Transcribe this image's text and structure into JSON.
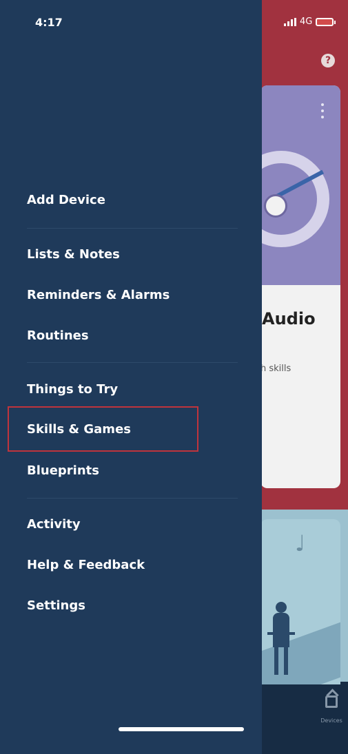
{
  "status_bar": {
    "time": "4:17",
    "network": "4G"
  },
  "drawer": {
    "items": [
      {
        "label": "Add Device"
      },
      {
        "label": "Lists & Notes"
      },
      {
        "label": "Reminders & Alarms"
      },
      {
        "label": "Routines"
      },
      {
        "label": "Things to Try"
      },
      {
        "label": "Skills & Games",
        "highlighted": true
      },
      {
        "label": "Blueprints"
      },
      {
        "label": "Activity"
      },
      {
        "label": "Help & Feedback"
      },
      {
        "label": "Settings"
      }
    ]
  },
  "background_app": {
    "help_icon_label": "?",
    "card_title": "Audio",
    "card_subtitle": "h skills",
    "bottom_tab_label": "Devices"
  },
  "colors": {
    "drawer_bg": "#1f3a5a",
    "accent_red": "#a1323f",
    "highlight_border": "#c0343c"
  }
}
